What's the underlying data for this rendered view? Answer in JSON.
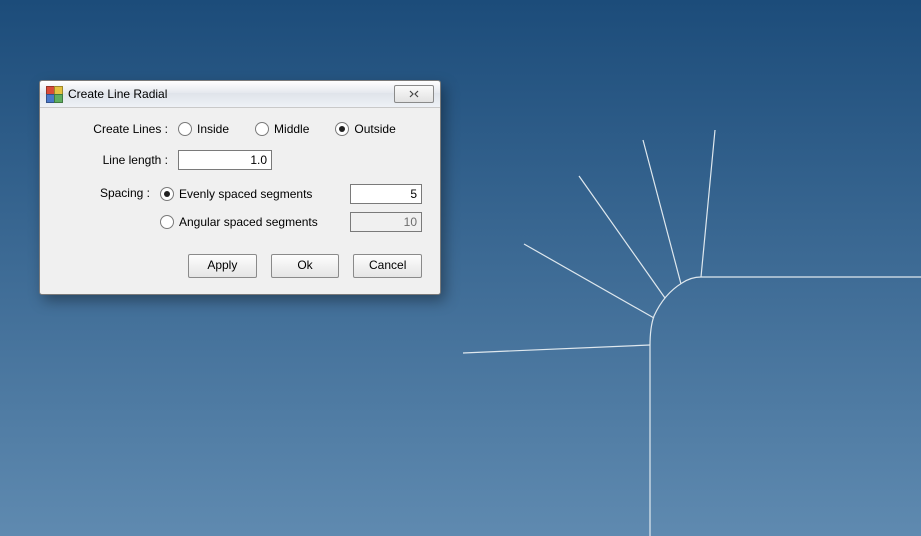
{
  "dialog": {
    "title": "Create Line Radial",
    "labels": {
      "create_lines": "Create Lines :",
      "line_length": "Line length :",
      "spacing": "Spacing :"
    },
    "create_lines_options": {
      "inside": {
        "label": "Inside",
        "checked": false
      },
      "middle": {
        "label": "Middle",
        "checked": false
      },
      "outside": {
        "label": "Outside",
        "checked": true
      }
    },
    "line_length_value": "1.0",
    "spacing_options": {
      "even": {
        "label": "Evenly spaced segments",
        "checked": true,
        "value": "5"
      },
      "angular": {
        "label": "Angular spaced segments",
        "checked": false,
        "value": "10"
      }
    },
    "buttons": {
      "apply": "Apply",
      "ok": "Ok",
      "cancel": "Cancel"
    }
  },
  "colors": {
    "line": "#dfe8ee"
  }
}
